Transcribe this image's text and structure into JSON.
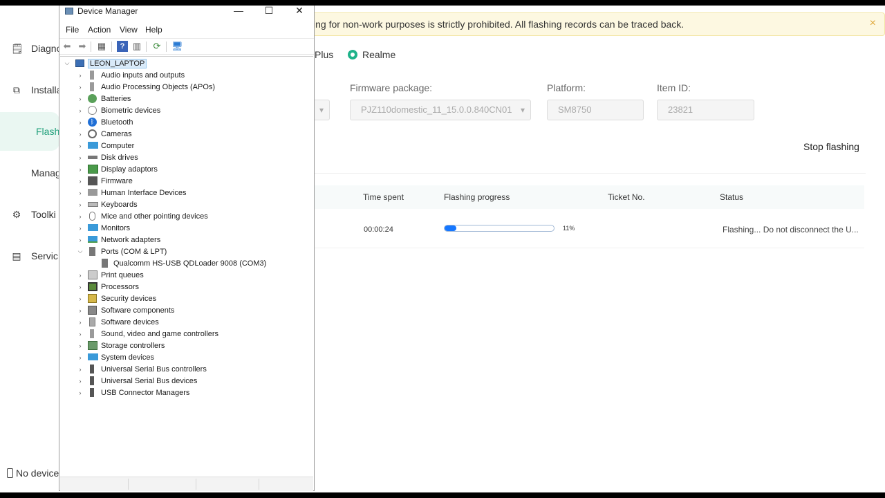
{
  "sidebar": {
    "items": [
      {
        "label": "Diagno",
        "icon": "diagnose-icon",
        "active": false
      },
      {
        "label": "Installa",
        "icon": "install-icon",
        "active": false
      },
      {
        "label": "Flash",
        "icon": "",
        "active": true
      },
      {
        "label": "Manag",
        "icon": "",
        "active": false
      },
      {
        "label": "Toolki",
        "icon": "toolkit-icon",
        "active": false
      },
      {
        "label": "Servic",
        "icon": "service-icon",
        "active": false
      }
    ],
    "device_status": "No device"
  },
  "banner": {
    "text": "ing for non-work purposes is strictly prohibited. All flashing records can be traced back.",
    "close": "×"
  },
  "brands": {
    "plus": "Plus",
    "realme": "Realme"
  },
  "fields": {
    "firmware_label": "Firmware package:",
    "firmware_value": "PJZ110domestic_11_15.0.0.840CN01",
    "platform_label": "Platform:",
    "platform_value": "SM8750",
    "item_label": "Item ID:",
    "item_value": "23821"
  },
  "stop_button": "Stop flashing",
  "table": {
    "headers": {
      "time": "Time spent",
      "progress": "Flashing progress",
      "ticket": "Ticket No.",
      "status": "Status"
    },
    "row": {
      "time": "00:00:24",
      "progress_percent": 11,
      "progress_label": "11%",
      "ticket": "",
      "status": "Flashing... Do not disconnect the U..."
    }
  },
  "colors": {
    "accent": "#1fb38a",
    "progress": "#1677ff",
    "banner_bg": "#fdf8e1"
  },
  "device_manager": {
    "title": "Device Manager",
    "window_buttons": {
      "minimize": "—",
      "maximize": "☐",
      "close": "✕"
    },
    "menu": [
      "File",
      "Action",
      "View",
      "Help"
    ],
    "root": "LEON_LAPTOP",
    "categories": [
      {
        "label": "Audio inputs and outputs",
        "icon": "speaker-icon",
        "expanded": false
      },
      {
        "label": "Audio Processing Objects (APOs)",
        "icon": "speaker-icon",
        "expanded": false
      },
      {
        "label": "Batteries",
        "icon": "battery-icon",
        "expanded": false
      },
      {
        "label": "Biometric devices",
        "icon": "fingerprint-icon",
        "expanded": false
      },
      {
        "label": "Bluetooth",
        "icon": "bluetooth-icon",
        "expanded": false
      },
      {
        "label": "Cameras",
        "icon": "camera-icon",
        "expanded": false
      },
      {
        "label": "Computer",
        "icon": "monitor-icon",
        "expanded": false
      },
      {
        "label": "Disk drives",
        "icon": "disk-icon",
        "expanded": false
      },
      {
        "label": "Display adaptors",
        "icon": "display-adapter-icon",
        "expanded": false
      },
      {
        "label": "Firmware",
        "icon": "firmware-icon",
        "expanded": false
      },
      {
        "label": "Human Interface Devices",
        "icon": "hid-icon",
        "expanded": false
      },
      {
        "label": "Keyboards",
        "icon": "keyboard-icon",
        "expanded": false
      },
      {
        "label": "Mice and other pointing devices",
        "icon": "mouse-icon",
        "expanded": false
      },
      {
        "label": "Monitors",
        "icon": "monitor-icon",
        "expanded": false
      },
      {
        "label": "Network adapters",
        "icon": "network-icon",
        "expanded": false
      },
      {
        "label": "Ports (COM & LPT)",
        "icon": "port-icon",
        "expanded": true,
        "children": [
          "Qualcomm HS-USB QDLoader 9008 (COM3)"
        ]
      },
      {
        "label": "Print queues",
        "icon": "printer-icon",
        "expanded": false
      },
      {
        "label": "Processors",
        "icon": "processor-icon",
        "expanded": false
      },
      {
        "label": "Security devices",
        "icon": "security-icon",
        "expanded": false
      },
      {
        "label": "Software components",
        "icon": "software-component-icon",
        "expanded": false
      },
      {
        "label": "Software devices",
        "icon": "software-device-icon",
        "expanded": false
      },
      {
        "label": "Sound, video and game controllers",
        "icon": "speaker-icon",
        "expanded": false
      },
      {
        "label": "Storage controllers",
        "icon": "storage-icon",
        "expanded": false
      },
      {
        "label": "System devices",
        "icon": "system-icon",
        "expanded": false
      },
      {
        "label": "Universal Serial Bus controllers",
        "icon": "usb-icon",
        "expanded": false
      },
      {
        "label": "Universal Serial Bus devices",
        "icon": "usb-icon",
        "expanded": false
      },
      {
        "label": "USB Connector Managers",
        "icon": "usb-icon",
        "expanded": false
      }
    ]
  }
}
